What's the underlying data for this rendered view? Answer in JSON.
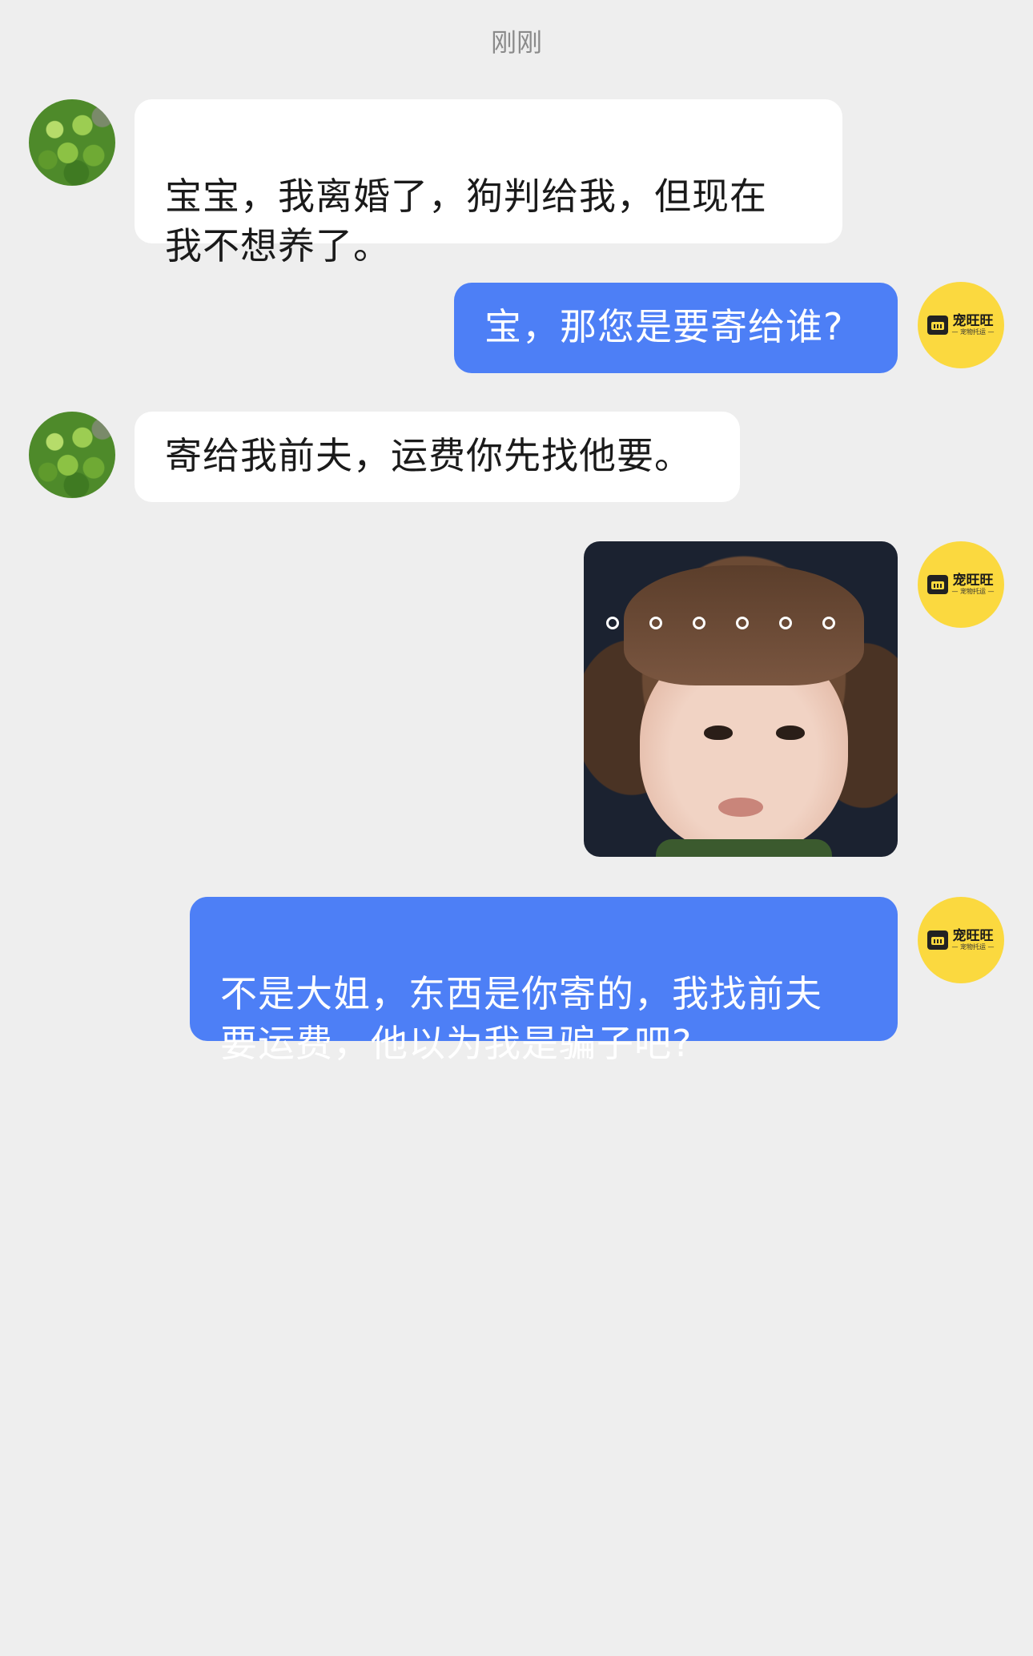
{
  "chat": {
    "timestamp": "刚刚",
    "messages": [
      {
        "sender": "customer",
        "text": "宝宝，我离婚了，狗判给我，但现在\n我不想养了。"
      },
      {
        "sender": "shop",
        "text": "宝，那您是要寄给谁?"
      },
      {
        "sender": "customer",
        "text": "寄给我前夫，运费你先找他要。"
      },
      {
        "sender": "shop",
        "type": "image",
        "image_desc": "sticker-toddler-face"
      },
      {
        "sender": "shop",
        "text": "不是大姐，东西是你寄的，我找前夫\n要运费，他以为我是骗子吧?"
      }
    ]
  },
  "shop_avatar": {
    "name": "宠旺旺",
    "subtitle": "— 宠物托运 —",
    "color": "#fbd93f"
  },
  "colors": {
    "background": "#eeeeee",
    "incoming_bubble": "#ffffff",
    "outgoing_bubble": "#4d7ff6"
  }
}
